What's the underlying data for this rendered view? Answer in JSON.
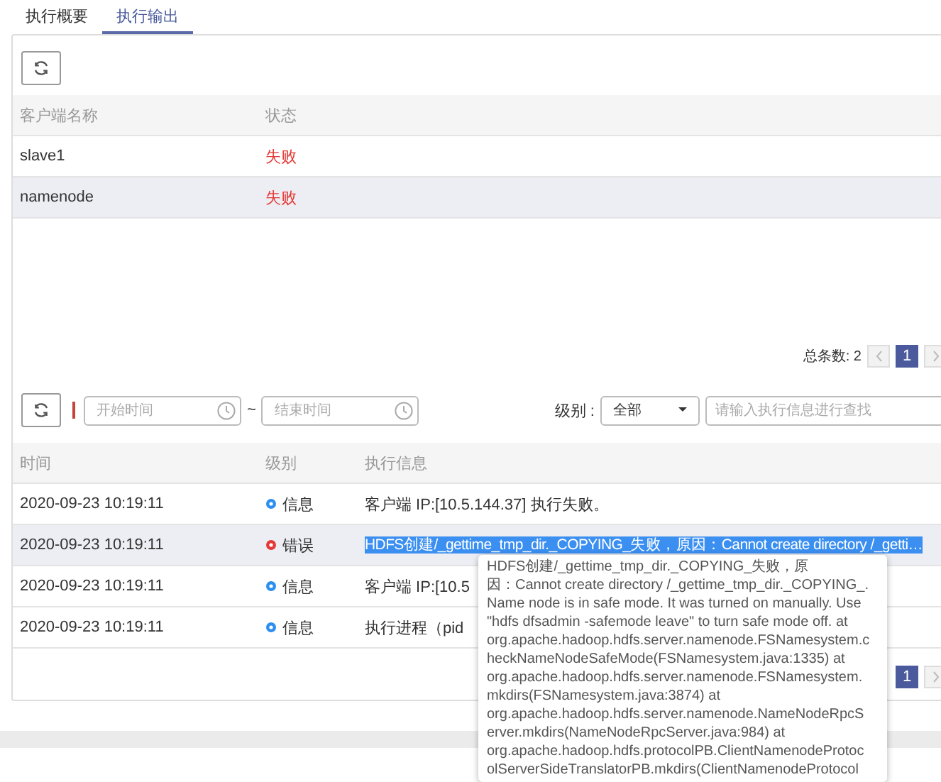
{
  "tabs": [
    {
      "label": "执行概要",
      "selected": false
    },
    {
      "label": "执行输出",
      "selected": true
    }
  ],
  "clients": {
    "columns": [
      "客户端名称",
      "状态"
    ],
    "rows": [
      {
        "name": "slave1",
        "status": "失败",
        "selected": false
      },
      {
        "name": "namenode",
        "status": "失败",
        "selected": true
      }
    ],
    "pagination": {
      "total_label": "总条数: 2",
      "pages": [
        {
          "label": "1",
          "selected": true
        }
      ]
    }
  },
  "filters": {
    "start_placeholder": "开始时间",
    "separator": "~",
    "end_placeholder": "结束时间",
    "level_label": "级别 :",
    "level_value": "全部",
    "search_placeholder": "请输入执行信息进行查找"
  },
  "logs": {
    "columns": [
      "时间",
      "级别",
      "执行信息"
    ],
    "rows": [
      {
        "time": "2020-09-23 10:19:11",
        "kind": "info",
        "level_text": "信息",
        "message": "客户端 IP:[10.5.144.37] 执行失败。",
        "selected": false,
        "highlighted": false
      },
      {
        "time": "2020-09-23 10:19:11",
        "kind": "error",
        "level_text": "错误",
        "message": "HDFS创建/_gettime_tmp_dir._COPYING_失败，原因：Cannot create directory /_getti…",
        "selected": true,
        "highlighted": true
      },
      {
        "time": "2020-09-23 10:19:11",
        "kind": "info",
        "level_text": "信息",
        "message": "客户端 IP:[10.5",
        "selected": false,
        "highlighted": false
      },
      {
        "time": "2020-09-23 10:19:11",
        "kind": "info",
        "level_text": "信息",
        "message": "执行进程（pid",
        "selected": false,
        "highlighted": false
      }
    ],
    "pagination": {
      "pages": [
        {
          "label": "1",
          "selected": true
        }
      ]
    }
  },
  "tooltip": {
    "lines": [
      "HDFS创建/_gettime_tmp_dir._COPYING_失败，原",
      "因：Cannot create directory /_gettime_tmp_dir._COPYING_.",
      "Name node is in safe mode. It was turned on manually. Use",
      "\"hdfs dfsadmin -safemode leave\" to turn safe mode off. at",
      "org.apache.hadoop.hdfs.server.namenode.FSNamesystem.c",
      "heckNameNodeSafeMode(FSNamesystem.java:1335) at",
      "org.apache.hadoop.hdfs.server.namenode.FSNamesystem.",
      "mkdirs(FSNamesystem.java:3874) at",
      "org.apache.hadoop.hdfs.server.namenode.NameNodeRpcS",
      "erver.mkdirs(NameNodeRpcServer.java:984) at",
      "org.apache.hadoop.hdfs.protocolPB.ClientNamenodeProtoc",
      "olServerSideTranslatorPB.mkdirs(ClientNamenodeProtocol"
    ]
  }
}
